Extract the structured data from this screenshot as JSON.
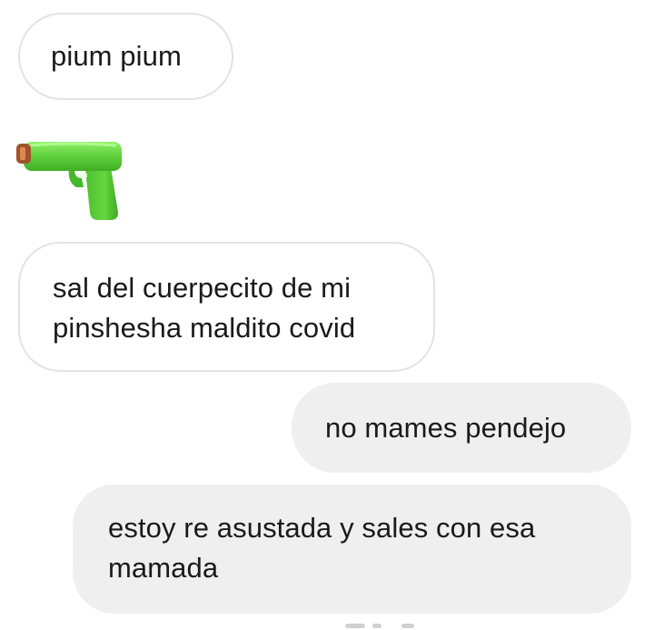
{
  "messages": [
    {
      "side": "received",
      "text": "pium pium"
    },
    {
      "side": "received",
      "emoji": "water-pistol-icon"
    },
    {
      "side": "received",
      "lines": [
        "sal del cuerpecito de mi",
        "pinshesha maldito covid"
      ]
    },
    {
      "side": "sent",
      "text": "no mames pendejo"
    },
    {
      "side": "sent",
      "lines": [
        "estoy re asustada y sales con esa",
        "mamada"
      ]
    }
  ],
  "colors": {
    "received_bubble_bg": "#ffffff",
    "received_bubble_border": "#e3e3e3",
    "sent_bubble_bg": "#efefef",
    "text": "#1a1a1a",
    "pistol_body": "#5ecf3a",
    "pistol_muzzle": "#a0522d"
  }
}
